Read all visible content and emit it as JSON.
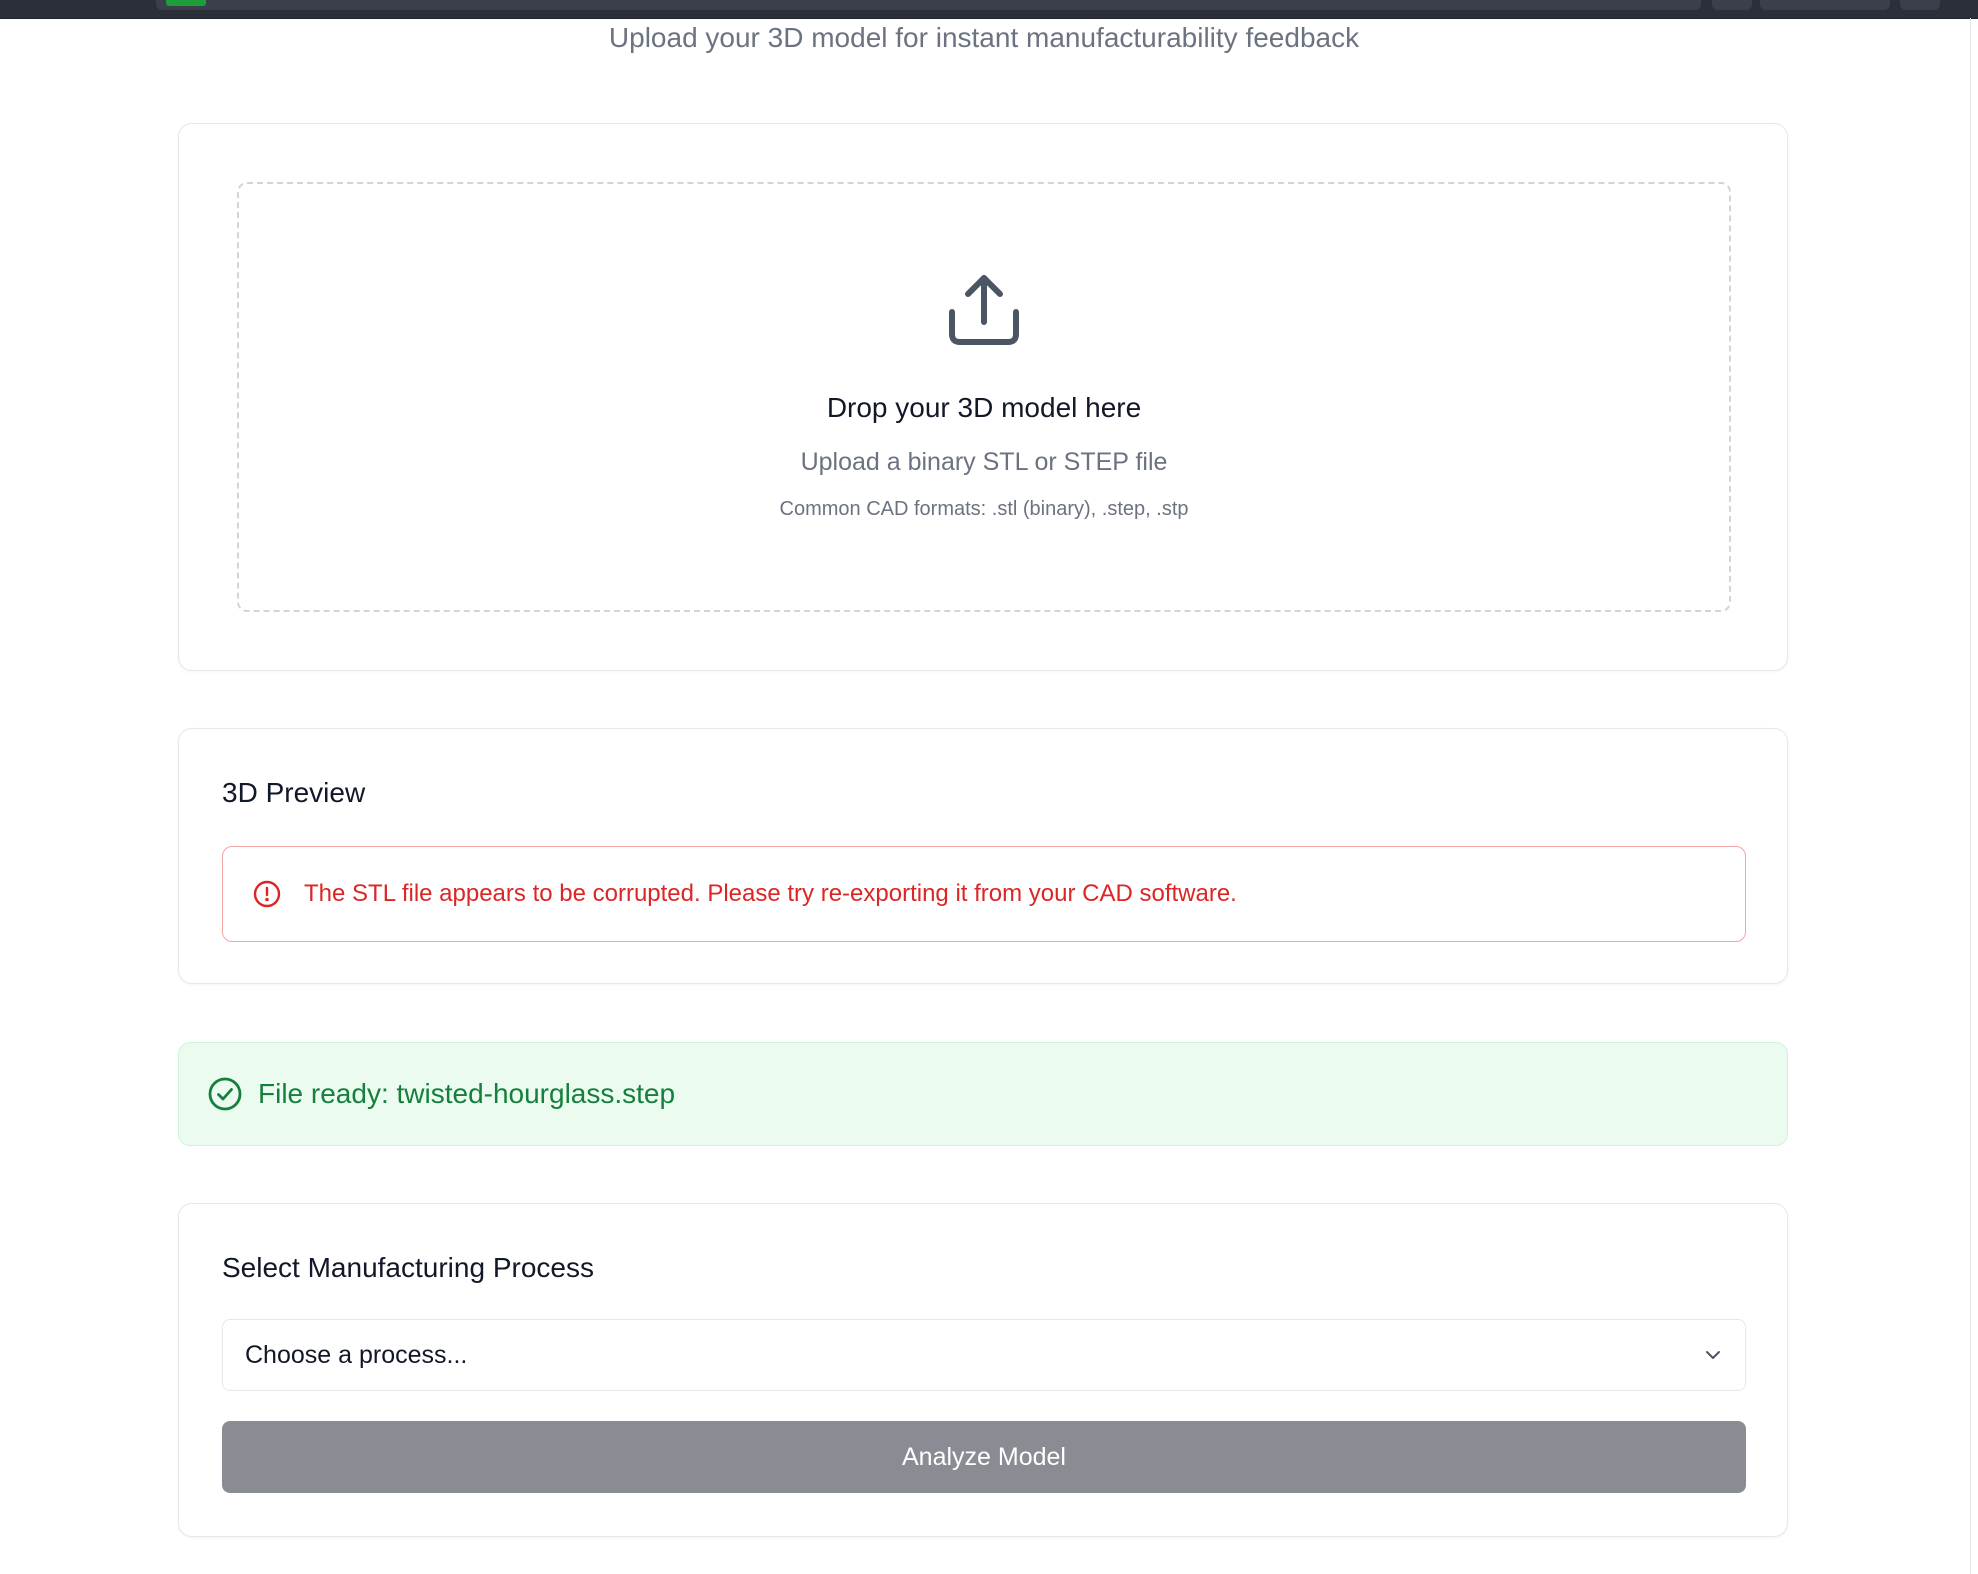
{
  "header": {
    "subtitle": "Upload your 3D model for instant manufacturability feedback"
  },
  "upload": {
    "icon": "upload-icon",
    "title": "Drop your 3D model here",
    "subtitle": "Upload a binary STL or STEP file",
    "formats": "Common CAD formats: .stl (binary), .step, .stp"
  },
  "preview": {
    "heading": "3D Preview",
    "error_icon": "alert-circle-icon",
    "error_message": "The STL file appears to be corrupted. Please try re-exporting it from your CAD software.",
    "error_color": "#dc2626"
  },
  "file_status": {
    "icon": "check-circle-icon",
    "message": "File ready: twisted-hourglass.step",
    "color": "#15803d",
    "background": "#ebfbef"
  },
  "process": {
    "heading": "Select Manufacturing Process",
    "select_value": "Choose a process...",
    "chevron_icon": "chevron-down-icon",
    "analyze_label": "Analyze Model",
    "analyze_button_color": "#898c93"
  }
}
